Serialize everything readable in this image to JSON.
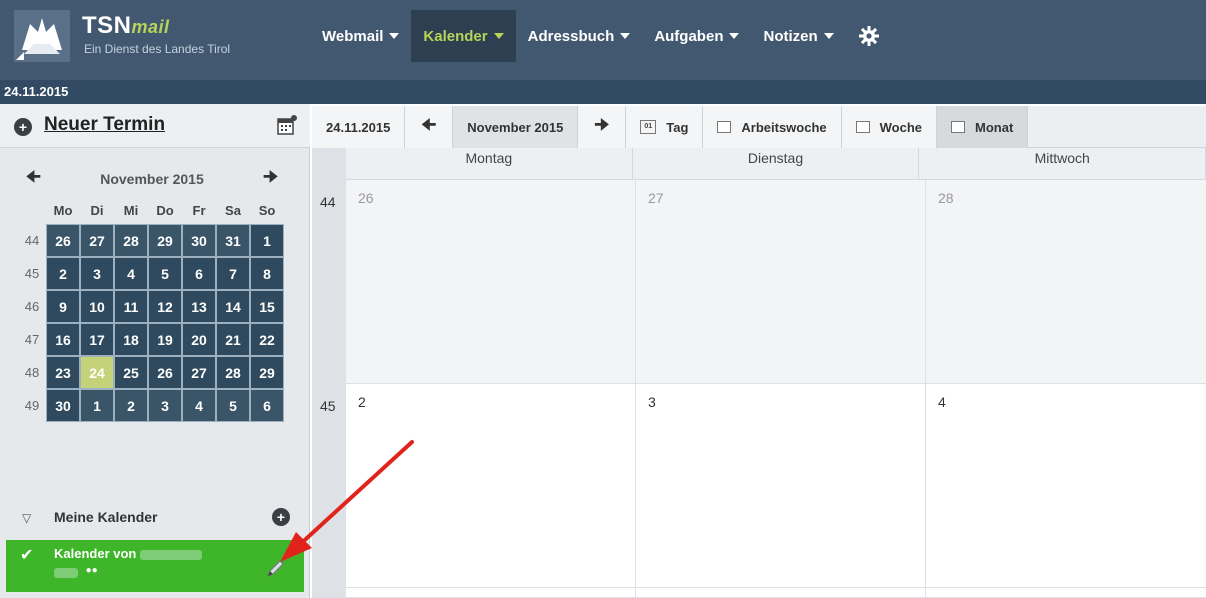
{
  "app": {
    "brand": "TSN",
    "brand_suffix": "mail",
    "subtitle": "Ein Dienst des Landes Tirol"
  },
  "nav": [
    {
      "label": "Webmail"
    },
    {
      "label": "Kalender"
    },
    {
      "label": "Adressbuch"
    },
    {
      "label": "Aufgaben"
    },
    {
      "label": "Notizen"
    }
  ],
  "current_date": "24.11.2015",
  "sidebar": {
    "new_appointment_label": "Neuer Termin",
    "minical": {
      "month": "November 2015",
      "weekday_headers": [
        "Mo",
        "Di",
        "Mi",
        "Do",
        "Fr",
        "Sa",
        "So"
      ],
      "weeks": [
        {
          "week": "44",
          "days": [
            "26",
            "27",
            "28",
            "29",
            "30",
            "31",
            "1"
          ]
        },
        {
          "week": "45",
          "days": [
            "2",
            "3",
            "4",
            "5",
            "6",
            "7",
            "8"
          ]
        },
        {
          "week": "46",
          "days": [
            "9",
            "10",
            "11",
            "12",
            "13",
            "14",
            "15"
          ]
        },
        {
          "week": "47",
          "days": [
            "16",
            "17",
            "18",
            "19",
            "20",
            "21",
            "22"
          ]
        },
        {
          "week": "48",
          "days": [
            "23",
            "24",
            "25",
            "26",
            "27",
            "28",
            "29"
          ]
        },
        {
          "week": "49",
          "days": [
            "30",
            "1",
            "2",
            "3",
            "4",
            "5",
            "6"
          ]
        }
      ],
      "today": "24"
    },
    "my_calendars_label": "Meine Kalender",
    "calendar_entry_label": "Kalender von"
  },
  "toolbar": {
    "date": "24.11.2015",
    "month_label": "November 2015",
    "views": {
      "day": "Tag",
      "workweek": "Arbeitswoche",
      "week": "Woche",
      "month": "Monat"
    },
    "day_icon_text": "01"
  },
  "calendar": {
    "day_headers": [
      "Montag",
      "Dienstag",
      "Mittwoch"
    ],
    "rows": [
      {
        "week": "44",
        "days": [
          "26",
          "27",
          "28"
        ],
        "prev_month": true
      },
      {
        "week": "45",
        "days": [
          "2",
          "3",
          "4"
        ],
        "prev_month": false
      }
    ]
  },
  "colors": {
    "header_bg": "#425870",
    "accent_green": "#b6d35a",
    "calendar_entry": "#3fb52a",
    "minical_day": "#2f4a5e",
    "today": "#c4d27a",
    "annotation_arrow": "#e0241b"
  }
}
